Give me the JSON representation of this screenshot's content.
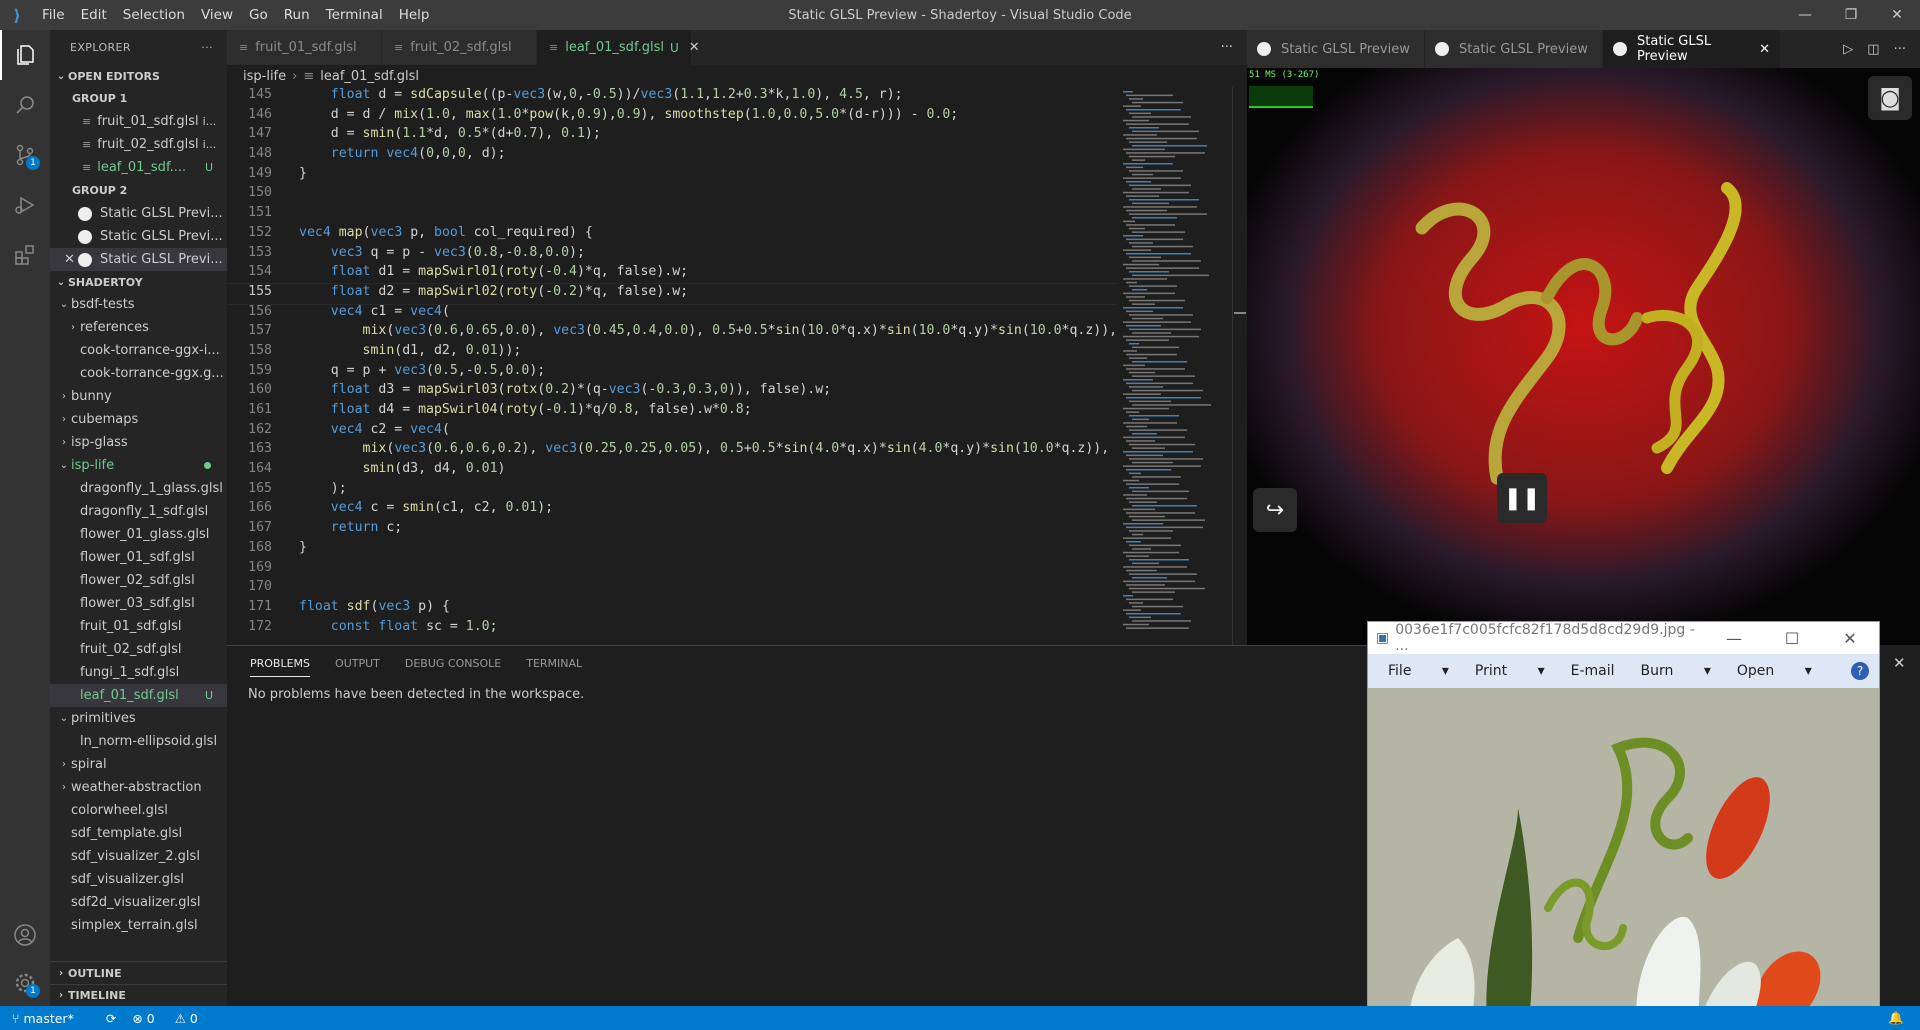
{
  "window": {
    "title": "Static GLSL Preview - Shadertoy - Visual Studio Code",
    "menu": [
      "File",
      "Edit",
      "Selection",
      "View",
      "Go",
      "Run",
      "Terminal",
      "Help"
    ]
  },
  "activity_bar": {
    "scm_badge": "1",
    "settings_badge": "1"
  },
  "sidebar": {
    "header": "EXPLORER",
    "open_editors_label": "OPEN EDITORS",
    "group1_label": "GROUP 1",
    "group1": [
      {
        "name": "fruit_01_sdf.glsl",
        "suffix": "i..."
      },
      {
        "name": "fruit_02_sdf.glsl",
        "suffix": "i..."
      },
      {
        "name": "leaf_01_sdf....",
        "suffix": "U"
      }
    ],
    "group2_label": "GROUP 2",
    "group2": [
      "Static GLSL Previ...",
      "Static GLSL Previ...",
      "Static GLSL Previ..."
    ],
    "workspace_label": "SHADERTOY",
    "tree": [
      {
        "label": "bsdf-tests",
        "chev": "⌄",
        "indent": 1
      },
      {
        "label": "references",
        "chev": "›",
        "indent": 2
      },
      {
        "label": "cook-torrance-ggx-i...",
        "chev": "",
        "indent": 2
      },
      {
        "label": "cook-torrance-ggx.g...",
        "chev": "",
        "indent": 2
      },
      {
        "label": "bunny",
        "chev": "›",
        "indent": 1
      },
      {
        "label": "cubemaps",
        "chev": "›",
        "indent": 1
      },
      {
        "label": "isp-glass",
        "chev": "›",
        "indent": 1
      },
      {
        "label": "isp-life",
        "chev": "⌄",
        "indent": 1,
        "green": true
      },
      {
        "label": "dragonfly_1_glass.glsl",
        "chev": "",
        "indent": 2
      },
      {
        "label": "dragonfly_1_sdf.glsl",
        "chev": "",
        "indent": 2
      },
      {
        "label": "flower_01_glass.glsl",
        "chev": "",
        "indent": 2
      },
      {
        "label": "flower_01_sdf.glsl",
        "chev": "",
        "indent": 2
      },
      {
        "label": "flower_02_sdf.glsl",
        "chev": "",
        "indent": 2
      },
      {
        "label": "flower_03_sdf.glsl",
        "chev": "",
        "indent": 2
      },
      {
        "label": "fruit_01_sdf.glsl",
        "chev": "",
        "indent": 2
      },
      {
        "label": "fruit_02_sdf.glsl",
        "chev": "",
        "indent": 2
      },
      {
        "label": "fungi_1_sdf.glsl",
        "chev": "",
        "indent": 2
      },
      {
        "label": "leaf_01_sdf.glsl",
        "chev": "",
        "indent": 2,
        "green": true,
        "selected": true,
        "badge": "U"
      },
      {
        "label": "primitives",
        "chev": "⌄",
        "indent": 1
      },
      {
        "label": "ln_norm-ellipsoid.glsl",
        "chev": "",
        "indent": 2
      },
      {
        "label": "spiral",
        "chev": "›",
        "indent": 1
      },
      {
        "label": "weather-abstraction",
        "chev": "›",
        "indent": 1
      },
      {
        "label": "colorwheel.glsl",
        "chev": "",
        "indent": 1
      },
      {
        "label": "sdf_template.glsl",
        "chev": "",
        "indent": 1
      },
      {
        "label": "sdf_visualizer_2.glsl",
        "chev": "",
        "indent": 1
      },
      {
        "label": "sdf_visualizer.glsl",
        "chev": "",
        "indent": 1
      },
      {
        "label": "sdf2d_visualizer.glsl",
        "chev": "",
        "indent": 1
      },
      {
        "label": "simplex_terrain.glsl",
        "chev": "",
        "indent": 1
      }
    ],
    "outline_label": "OUTLINE",
    "timeline_label": "TIMELINE"
  },
  "editor": {
    "tabs": [
      {
        "label": "fruit_01_sdf.glsl",
        "active": false
      },
      {
        "label": "fruit_02_sdf.glsl",
        "active": false
      },
      {
        "label": "leaf_01_sdf.glsl",
        "active": true,
        "badge": "U"
      }
    ],
    "breadcrumb": [
      "isp-life",
      "leaf_01_sdf.glsl"
    ],
    "current_line": 155,
    "lines": [
      {
        "n": 145,
        "t": "    float d = sdCapsule((p-vec3(w,0,-0.5))/vec3(1.1,1.2+0.3*k,1.0), 4.5, r);"
      },
      {
        "n": 146,
        "t": "    d = d / mix(1.0, max(1.0*pow(k,0.9),0.9), smoothstep(1.0,0.0,5.0*(d-r))) - 0.0;"
      },
      {
        "n": 147,
        "t": "    d = smin(1.1*d, 0.5*(d+0.7), 0.1);"
      },
      {
        "n": 148,
        "t": "    return vec4(0,0,0, d);"
      },
      {
        "n": 149,
        "t": "}"
      },
      {
        "n": 150,
        "t": ""
      },
      {
        "n": 151,
        "t": ""
      },
      {
        "n": 152,
        "t": "vec4 map(vec3 p, bool col_required) {"
      },
      {
        "n": 153,
        "t": "    vec3 q = p - vec3(0.8,-0.8,0.0);"
      },
      {
        "n": 154,
        "t": "    float d1 = mapSwirl01(roty(-0.4)*q, false).w;"
      },
      {
        "n": 155,
        "t": "    float d2 = mapSwirl02(roty(-0.2)*q, false).w;"
      },
      {
        "n": 156,
        "t": "    vec4 c1 = vec4("
      },
      {
        "n": 157,
        "t": "        mix(vec3(0.6,0.65,0.0), vec3(0.45,0.4,0.0), 0.5+0.5*sin(10.0*q.x)*sin(10.0*q.y)*sin(10.0*q.z)),"
      },
      {
        "n": 158,
        "t": "        smin(d1, d2, 0.01));"
      },
      {
        "n": 159,
        "t": "    q = p + vec3(0.5,-0.5,0.0);"
      },
      {
        "n": 160,
        "t": "    float d3 = mapSwirl03(rotx(0.2)*(q-vec3(-0.3,0.3,0)), false).w;"
      },
      {
        "n": 161,
        "t": "    float d4 = mapSwirl04(roty(-0.1)*q/0.8, false).w*0.8;"
      },
      {
        "n": 162,
        "t": "    vec4 c2 = vec4("
      },
      {
        "n": 163,
        "t": "        mix(vec3(0.6,0.6,0.2), vec3(0.25,0.25,0.05), 0.5+0.5*sin(4.0*q.x)*sin(4.0*q.y)*sin(10.0*q.z)),"
      },
      {
        "n": 164,
        "t": "        smin(d3, d4, 0.01)"
      },
      {
        "n": 165,
        "t": "    );"
      },
      {
        "n": 166,
        "t": "    vec4 c = smin(c1, c2, 0.01);"
      },
      {
        "n": 167,
        "t": "    return c;"
      },
      {
        "n": 168,
        "t": "}"
      },
      {
        "n": 169,
        "t": ""
      },
      {
        "n": 170,
        "t": ""
      },
      {
        "n": 171,
        "t": "float sdf(vec3 p) {"
      },
      {
        "n": 172,
        "t": "    const float sc = 1.0;"
      }
    ]
  },
  "panel": {
    "tabs": [
      "PROBLEMS",
      "OUTPUT",
      "DEBUG CONSOLE",
      "TERMINAL"
    ],
    "message": "No problems have been detected in the workspace."
  },
  "preview": {
    "tabs": [
      "Static GLSL Preview",
      "Static GLSL Preview",
      "Static GLSL Preview"
    ],
    "fps": "51 MS (3-267)"
  },
  "image_viewer": {
    "title": "0036e1f7c005fcfc82f178d5d8cd29d9.jpg - ...",
    "menu": [
      "File",
      "Print",
      "E-mail",
      "Burn",
      "Open"
    ]
  },
  "status": {
    "branch": "master*",
    "errors": "0",
    "warnings": "0"
  },
  "colors": {
    "accent": "#007acc",
    "untracked": "#73c991"
  }
}
